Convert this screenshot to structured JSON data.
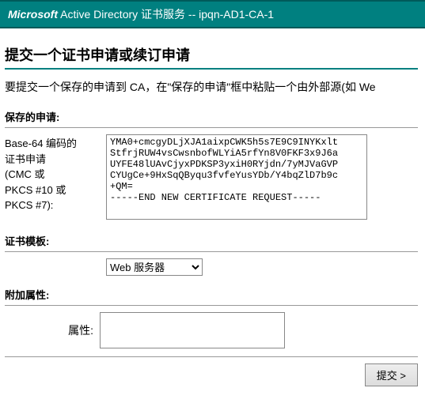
{
  "header": {
    "brand": "Microsoft",
    "product": " Active Directory 证书服务  --  ipqn-AD1-CA-1"
  },
  "title": "提交一个证书申请或续订申请",
  "intro": "要提交一个保存的申请到 CA，在\"保存的申请\"框中粘贴一个由外部源(如 We",
  "savedRequest": {
    "sectionLabel": "保存的申请:",
    "fieldLabel": "Base-64 编码的\n证书申请\n(CMC 或\nPKCS #10 或\nPKCS #7):",
    "value": "YMA0+cmcgyDLjXJA1aixpCWK5h5s7E9C9INYKxlt\nStfrjRUW4vsCwsnbofWLYiA5rfYn8V0FKF3x9J6a\nUYFE48lUAvCjyxPDKSP3yxiH0RYjdn/7yMJVaGVP\nCYUgCe+9HxSqQByqu3fvfeYusYDb/Y4bqZlD7b9c\n+QM=\n-----END NEW CERTIFICATE REQUEST-----"
  },
  "template": {
    "sectionLabel": "证书模板:",
    "selected": "Web 服务器"
  },
  "attributes": {
    "sectionLabel": "附加属性:",
    "fieldLabel": "属性:",
    "value": ""
  },
  "submitLabel": "提交 >"
}
